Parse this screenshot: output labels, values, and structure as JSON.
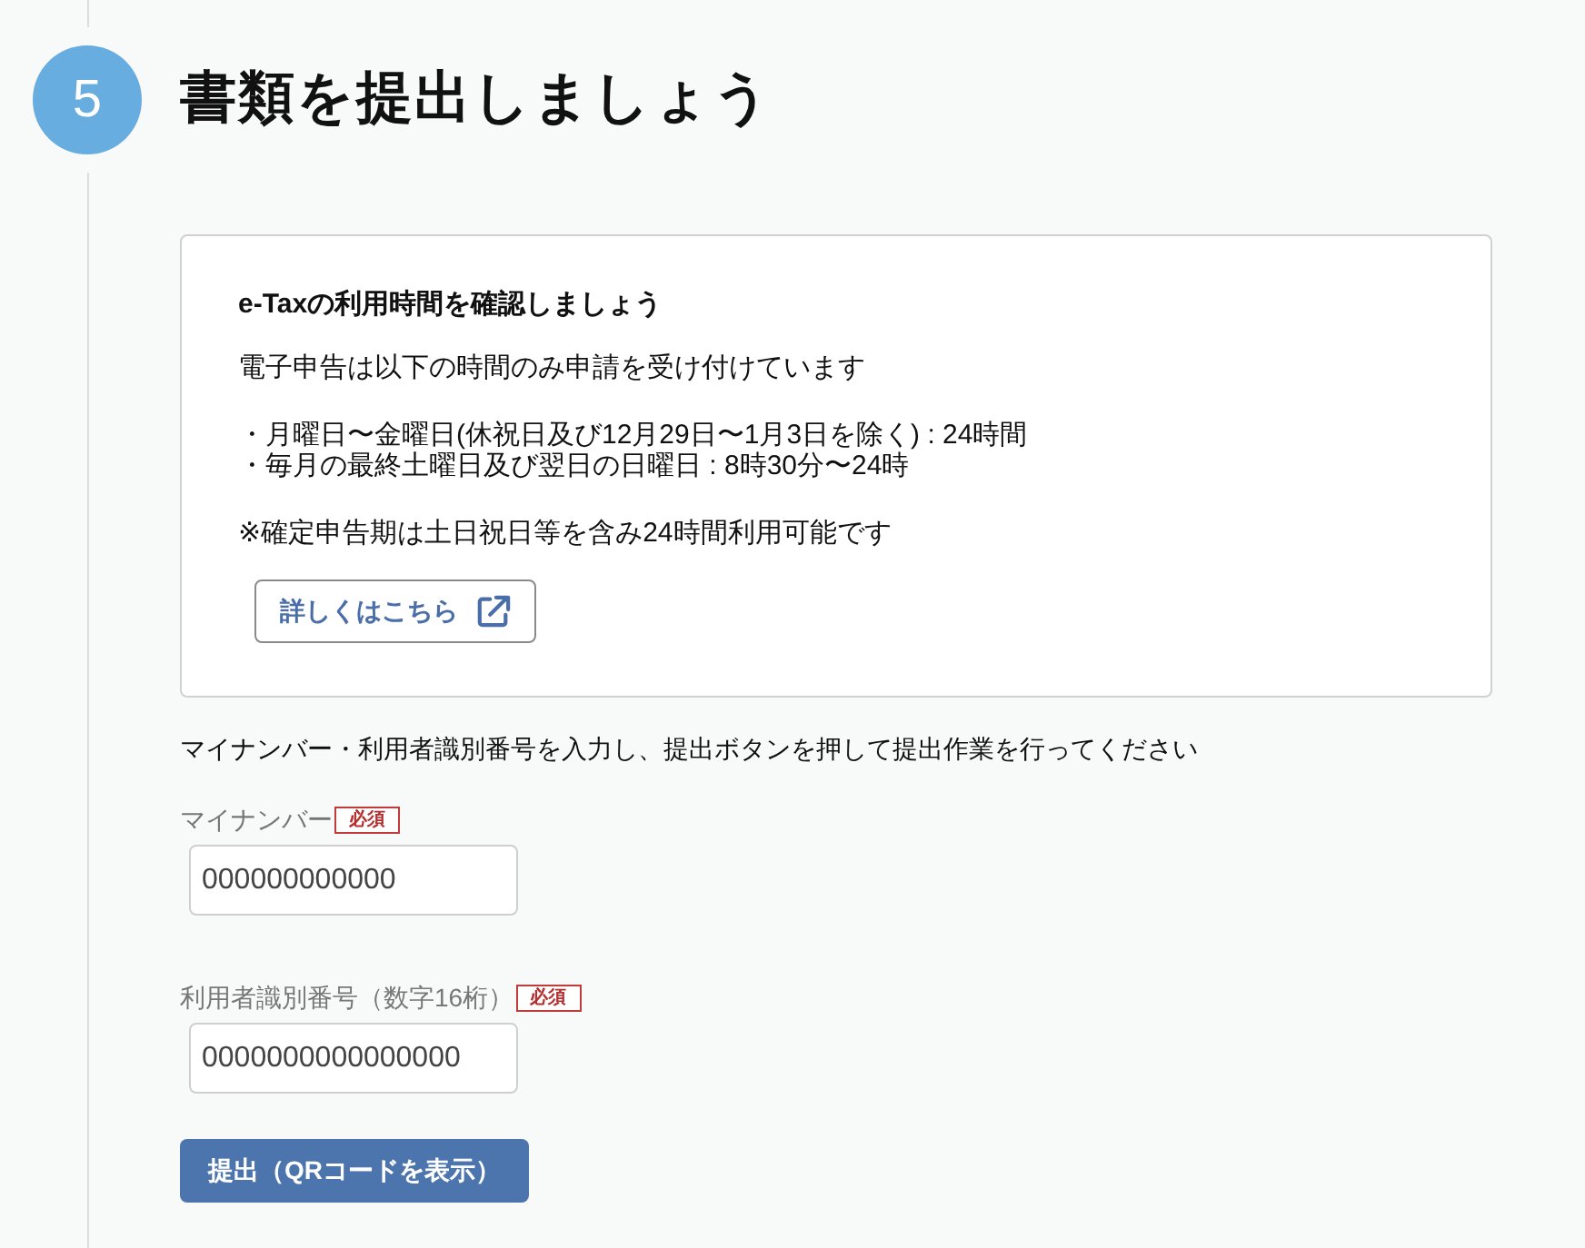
{
  "step": {
    "number": "5",
    "title": "書類を提出しましょう"
  },
  "notice": {
    "heading": "e-Taxの利用時間を確認しましょう",
    "intro": "電子申告は以下の時間のみ申請を受け付けています",
    "hours": [
      "・月曜日〜金曜日(休祝日及び12月29日〜1月3日を除く) : 24時間",
      "・毎月の最終土曜日及び翌日の日曜日 : 8時30分〜24時"
    ],
    "note": "※確定申告期は土日祝日等を含み24時間利用可能です",
    "link_button": "詳しくはこちら"
  },
  "instruction": "マイナンバー・利用者識別番号を入力し、提出ボタンを押して提出作業を行ってください",
  "fields": [
    {
      "label": "マイナンバー",
      "badge": "必須",
      "value": "000000000000"
    },
    {
      "label": "利用者識別番号（数字16桁）",
      "badge": "必須",
      "value": "0000000000000000"
    }
  ],
  "submit_button": "提出（QRコードを表示）"
}
